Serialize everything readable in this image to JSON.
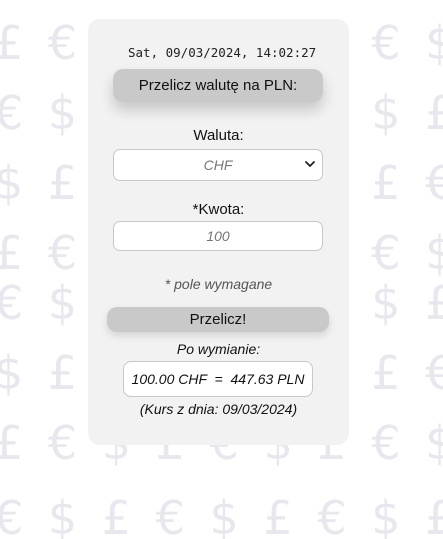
{
  "background": {
    "symbols_row_a": "£ € $ £ € $ £ € $ £ € $",
    "symbols_row_b": "€ $ £ € $ £ € $ £ € $ £",
    "symbols_row_c": "$ £ € $ £ € $ £ € $ £ €",
    "symbol_color": "#e7e7ee"
  },
  "clock": {
    "datetime": "Sat, 09/03/2024, 14:02:27"
  },
  "converter": {
    "title_button": "Przelicz walutę na PLN:",
    "currency_label": "Waluta:",
    "currency_selected": "CHF",
    "amount_label": "*Kwota:",
    "amount_value": "100",
    "required_note": "* pole wymagane",
    "convert_button": "Przelicz!",
    "after_label": "Po wymianie:",
    "result": "100.00 CHF  =  447.63 PLN",
    "rate_date_prefix": "(Kurs z dnia: ",
    "rate_date": "09/03/2024",
    "rate_date_suffix": ")"
  },
  "icons": {
    "select_chevron": "chevron-down-icon"
  },
  "colors": {
    "card_bg": "#f2f2f2",
    "button_bg": "#c9c9c9"
  }
}
